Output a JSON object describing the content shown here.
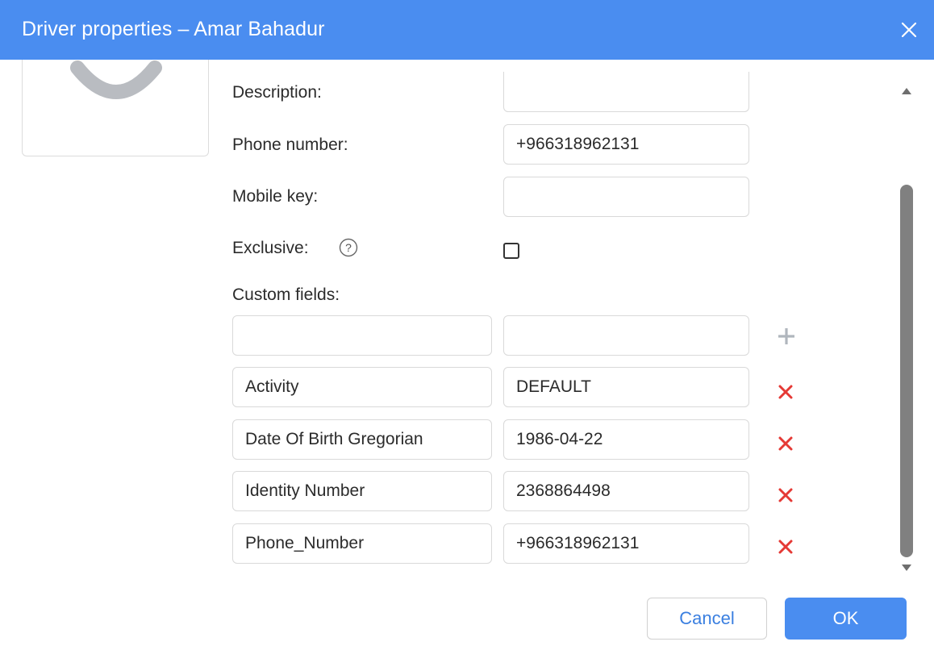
{
  "dialog": {
    "title": "Driver properties – Amar Bahadur"
  },
  "form": {
    "description_label": "Description:",
    "description_value": "",
    "phone_label": "Phone number:",
    "phone_value": "+966318962131",
    "mobile_key_label": "Mobile key:",
    "mobile_key_value": "",
    "exclusive_label": "Exclusive:",
    "exclusive_checked": false,
    "custom_fields_label": "Custom fields:"
  },
  "new_custom_field": {
    "key": "",
    "value": ""
  },
  "custom_fields": [
    {
      "key": "Activity",
      "value": "DEFAULT"
    },
    {
      "key": "Date Of Birth Gregorian",
      "value": "1986-04-22"
    },
    {
      "key": "Identity Number",
      "value": "2368864498"
    },
    {
      "key": "Phone_Number",
      "value": "+966318962131"
    }
  ],
  "buttons": {
    "cancel": "Cancel",
    "ok": "OK"
  },
  "colors": {
    "accent": "#4a8df0",
    "delete": "#e53935",
    "add": "#b0b6bd"
  },
  "icons": {
    "close": "close-icon",
    "help": "help-icon",
    "add": "plus-icon",
    "delete": "delete-x-icon",
    "photo": "avatar-placeholder-icon"
  }
}
